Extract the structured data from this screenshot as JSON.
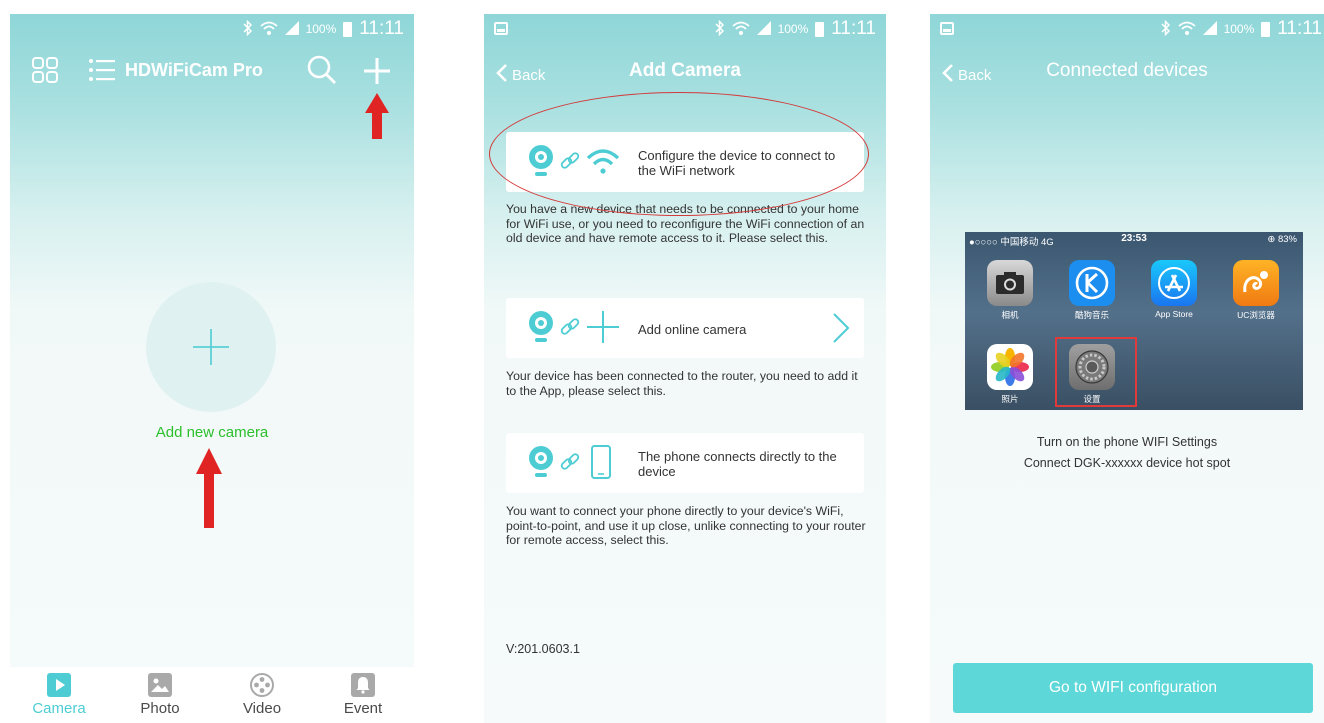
{
  "status_bar": {
    "battery": "100%",
    "time": "11:11"
  },
  "panel1": {
    "title": "HDWiFiCam Pro",
    "add_label": "Add new camera",
    "tabs": [
      {
        "label": "Camera",
        "icon": "play-icon",
        "active": true
      },
      {
        "label": "Photo",
        "icon": "image-icon",
        "active": false
      },
      {
        "label": "Video",
        "icon": "film-reel-icon",
        "active": false
      },
      {
        "label": "Event",
        "icon": "bell-icon",
        "active": false
      }
    ]
  },
  "panel2": {
    "back_label": "Back",
    "title": "Add Camera",
    "options": [
      {
        "label": "Configure the device to connect to the WiFi network",
        "description": "You have a new device that needs to be connected to your home for WiFi use, or you need to reconfigure the WiFi connection of an old device and have remote access to it. Please select this."
      },
      {
        "label": "Add online camera",
        "description": "Your device has been connected to the router, you need to add it to the App, please select this."
      },
      {
        "label": "The phone connects directly to the device",
        "description": "You want to connect your phone directly to your device's WiFi, point-to-point, and use it up close, unlike connecting to your router for remote access, select this."
      }
    ],
    "version": "V:201.0603.1"
  },
  "panel3": {
    "back_label": "Back",
    "title": "Connected devices",
    "ios_status": {
      "carrier": "●○○○○ 中国移动  4G",
      "time": "23:53",
      "battery": "⊕ 83%"
    },
    "apps": [
      {
        "label": "相机",
        "icon": "camera-app-icon"
      },
      {
        "label": "酷狗音乐",
        "icon": "kugou-app-icon"
      },
      {
        "label": "App Store",
        "icon": "app-store-icon"
      },
      {
        "label": "UC浏览器",
        "icon": "uc-browser-icon"
      },
      {
        "label": "照片",
        "icon": "photos-app-icon"
      },
      {
        "label": "设置",
        "icon": "settings-app-icon"
      }
    ],
    "instruction_line1": "Turn on the phone WIFI Settings",
    "instruction_line2": "Connect DGK-xxxxxx device hot spot",
    "button_label": "Go to WIFI configuration"
  },
  "colors": {
    "accent": "#4dcdd3",
    "button": "#5ed7d9",
    "add_label": "#2bbf2b",
    "annotation": "#e02424"
  }
}
